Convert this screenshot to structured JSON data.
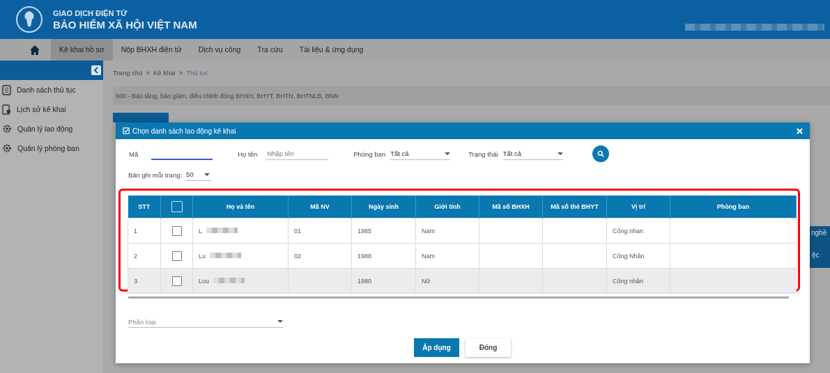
{
  "header": {
    "subtitle": "GIAO DỊCH ĐIỆN TỬ",
    "title": "BẢO HIỂM XÃ HỘI VIỆT NAM"
  },
  "nav": [
    {
      "label": "Kê khai hồ sơ",
      "selected": true
    },
    {
      "label": "Nộp BHXH điện tử",
      "selected": false
    },
    {
      "label": "Dịch vụ công",
      "selected": false
    },
    {
      "label": "Tra cứu",
      "selected": false
    },
    {
      "label": "Tài liệu & ứng dụng",
      "selected": false
    }
  ],
  "sidebar": {
    "items": [
      {
        "label": "Danh sách thủ tục"
      },
      {
        "label": "Lịch sử kê khai"
      },
      {
        "label": "Quản lý lao động"
      },
      {
        "label": "Quản lý phòng ban"
      }
    ]
  },
  "breadcrumb": [
    "Trang chủ",
    ">",
    "Kê khai",
    ">",
    "Thủ tục"
  ],
  "procedure": "600 - Báo tăng, báo giảm, điều chỉnh đóng BHXH, BHYT, BHTN, BHTNLĐ, BNN",
  "background_fragments": [
    "nghề",
    "ệc"
  ],
  "modal": {
    "title": "Chọn danh sách lao động kê khai",
    "filters": {
      "code_label": "Mã",
      "name_label": "Họ tên",
      "name_placeholder": "Nhập tên",
      "dept_label": "Phòng ban",
      "dept_value": "Tất cả",
      "status_label": "Trạng thái",
      "status_value": "Tất cả"
    },
    "per_page": {
      "label": "Bản ghi mỗi trang:",
      "value": "50"
    },
    "table": {
      "columns": [
        "STT",
        "",
        "Họ và tên",
        "Mã NV",
        "Ngày sinh",
        "Giới tính",
        "Mã số BHXH",
        "Mã số thẻ BHYT",
        "Vị trí",
        "Phòng ban"
      ],
      "all_checked": false,
      "rows": [
        {
          "stt": "1",
          "checked": false,
          "name": "L",
          "code": "01",
          "birth": "1985",
          "gender": "Nam",
          "bhxh": "",
          "bhyt": "",
          "position": "Công nhan",
          "dept": "",
          "hovered": false
        },
        {
          "stt": "2",
          "checked": false,
          "name": "Lu",
          "code": "02",
          "birth": "1988",
          "gender": "Nam",
          "bhxh": "",
          "bhyt": "",
          "position": "Công Nhân",
          "dept": "",
          "hovered": false
        },
        {
          "stt": "3",
          "checked": false,
          "name": "Luu",
          "code": "",
          "birth": "1980",
          "gender": "Nữ",
          "bhxh": "",
          "bhyt": "",
          "position": "Công nhân",
          "dept": "",
          "hovered": true
        }
      ]
    },
    "category_placeholder": "Phân loại",
    "buttons": [
      {
        "label": "Áp dụng",
        "kind": "primary"
      },
      {
        "label": "Đóng",
        "kind": "secondary"
      }
    ]
  }
}
